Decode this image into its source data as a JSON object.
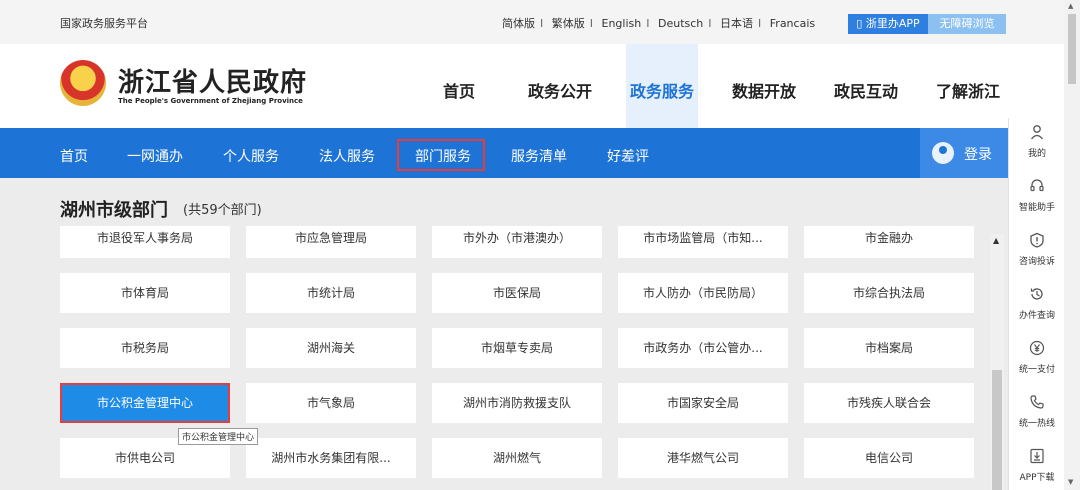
{
  "topbar": {
    "platform": "国家政务服务平台",
    "languages": [
      "简体版",
      "繁体版",
      "English",
      "Deutsch",
      "日本语",
      "Francais"
    ],
    "app_button": "浙里办APP",
    "accessible_button": "无障碍浏览"
  },
  "header": {
    "title": "浙江省人民政府",
    "subtitle": "The People's Government of Zhejiang Province"
  },
  "main_nav": [
    "首页",
    "政务公开",
    "政务服务",
    "数据开放",
    "政民互动",
    "了解浙江"
  ],
  "main_nav_active": "政务服务",
  "sub_nav": [
    "首页",
    "一网通办",
    "个人服务",
    "法人服务",
    "部门服务",
    "服务清单",
    "好差评"
  ],
  "sub_nav_selected": "部门服务",
  "login": "登录",
  "section": {
    "title": "湖州市级部门",
    "count": "(共59个部门)"
  },
  "departments": [
    [
      "市退役军人事务局",
      "市应急管理局",
      "市外办（市港澳办）",
      "市市场监管局（市知...",
      "市金融办"
    ],
    [
      "市体育局",
      "市统计局",
      "市医保局",
      "市人防办（市民防局）",
      "市综合执法局"
    ],
    [
      "市税务局",
      "湖州海关",
      "市烟草专卖局",
      "市政务办（市公管办...",
      "市档案局"
    ],
    [
      "市公积金管理中心",
      "市气象局",
      "湖州市消防救援支队",
      "市国家安全局",
      "市残疾人联合会"
    ],
    [
      "市供电公司",
      "湖州市水务集团有限...",
      "湖州燃气",
      "港华燃气公司",
      "电信公司"
    ]
  ],
  "selected_department": "市公积金管理中心",
  "tooltip": "市公积金管理中心",
  "side_panel": [
    {
      "icon": "user-icon",
      "label": "我的"
    },
    {
      "icon": "headset-icon",
      "label": "智能助手"
    },
    {
      "icon": "alert-icon",
      "label": "咨询投诉"
    },
    {
      "icon": "history-icon",
      "label": "办件查询"
    },
    {
      "icon": "yen-icon",
      "label": "统一支付"
    },
    {
      "icon": "phone-icon",
      "label": "统一热线"
    },
    {
      "icon": "download-icon",
      "label": "APP下载"
    }
  ],
  "colors": {
    "primary_blue": "#1e73d6",
    "highlight_red": "#e53c3c",
    "selected_cell": "#1e8be6"
  }
}
